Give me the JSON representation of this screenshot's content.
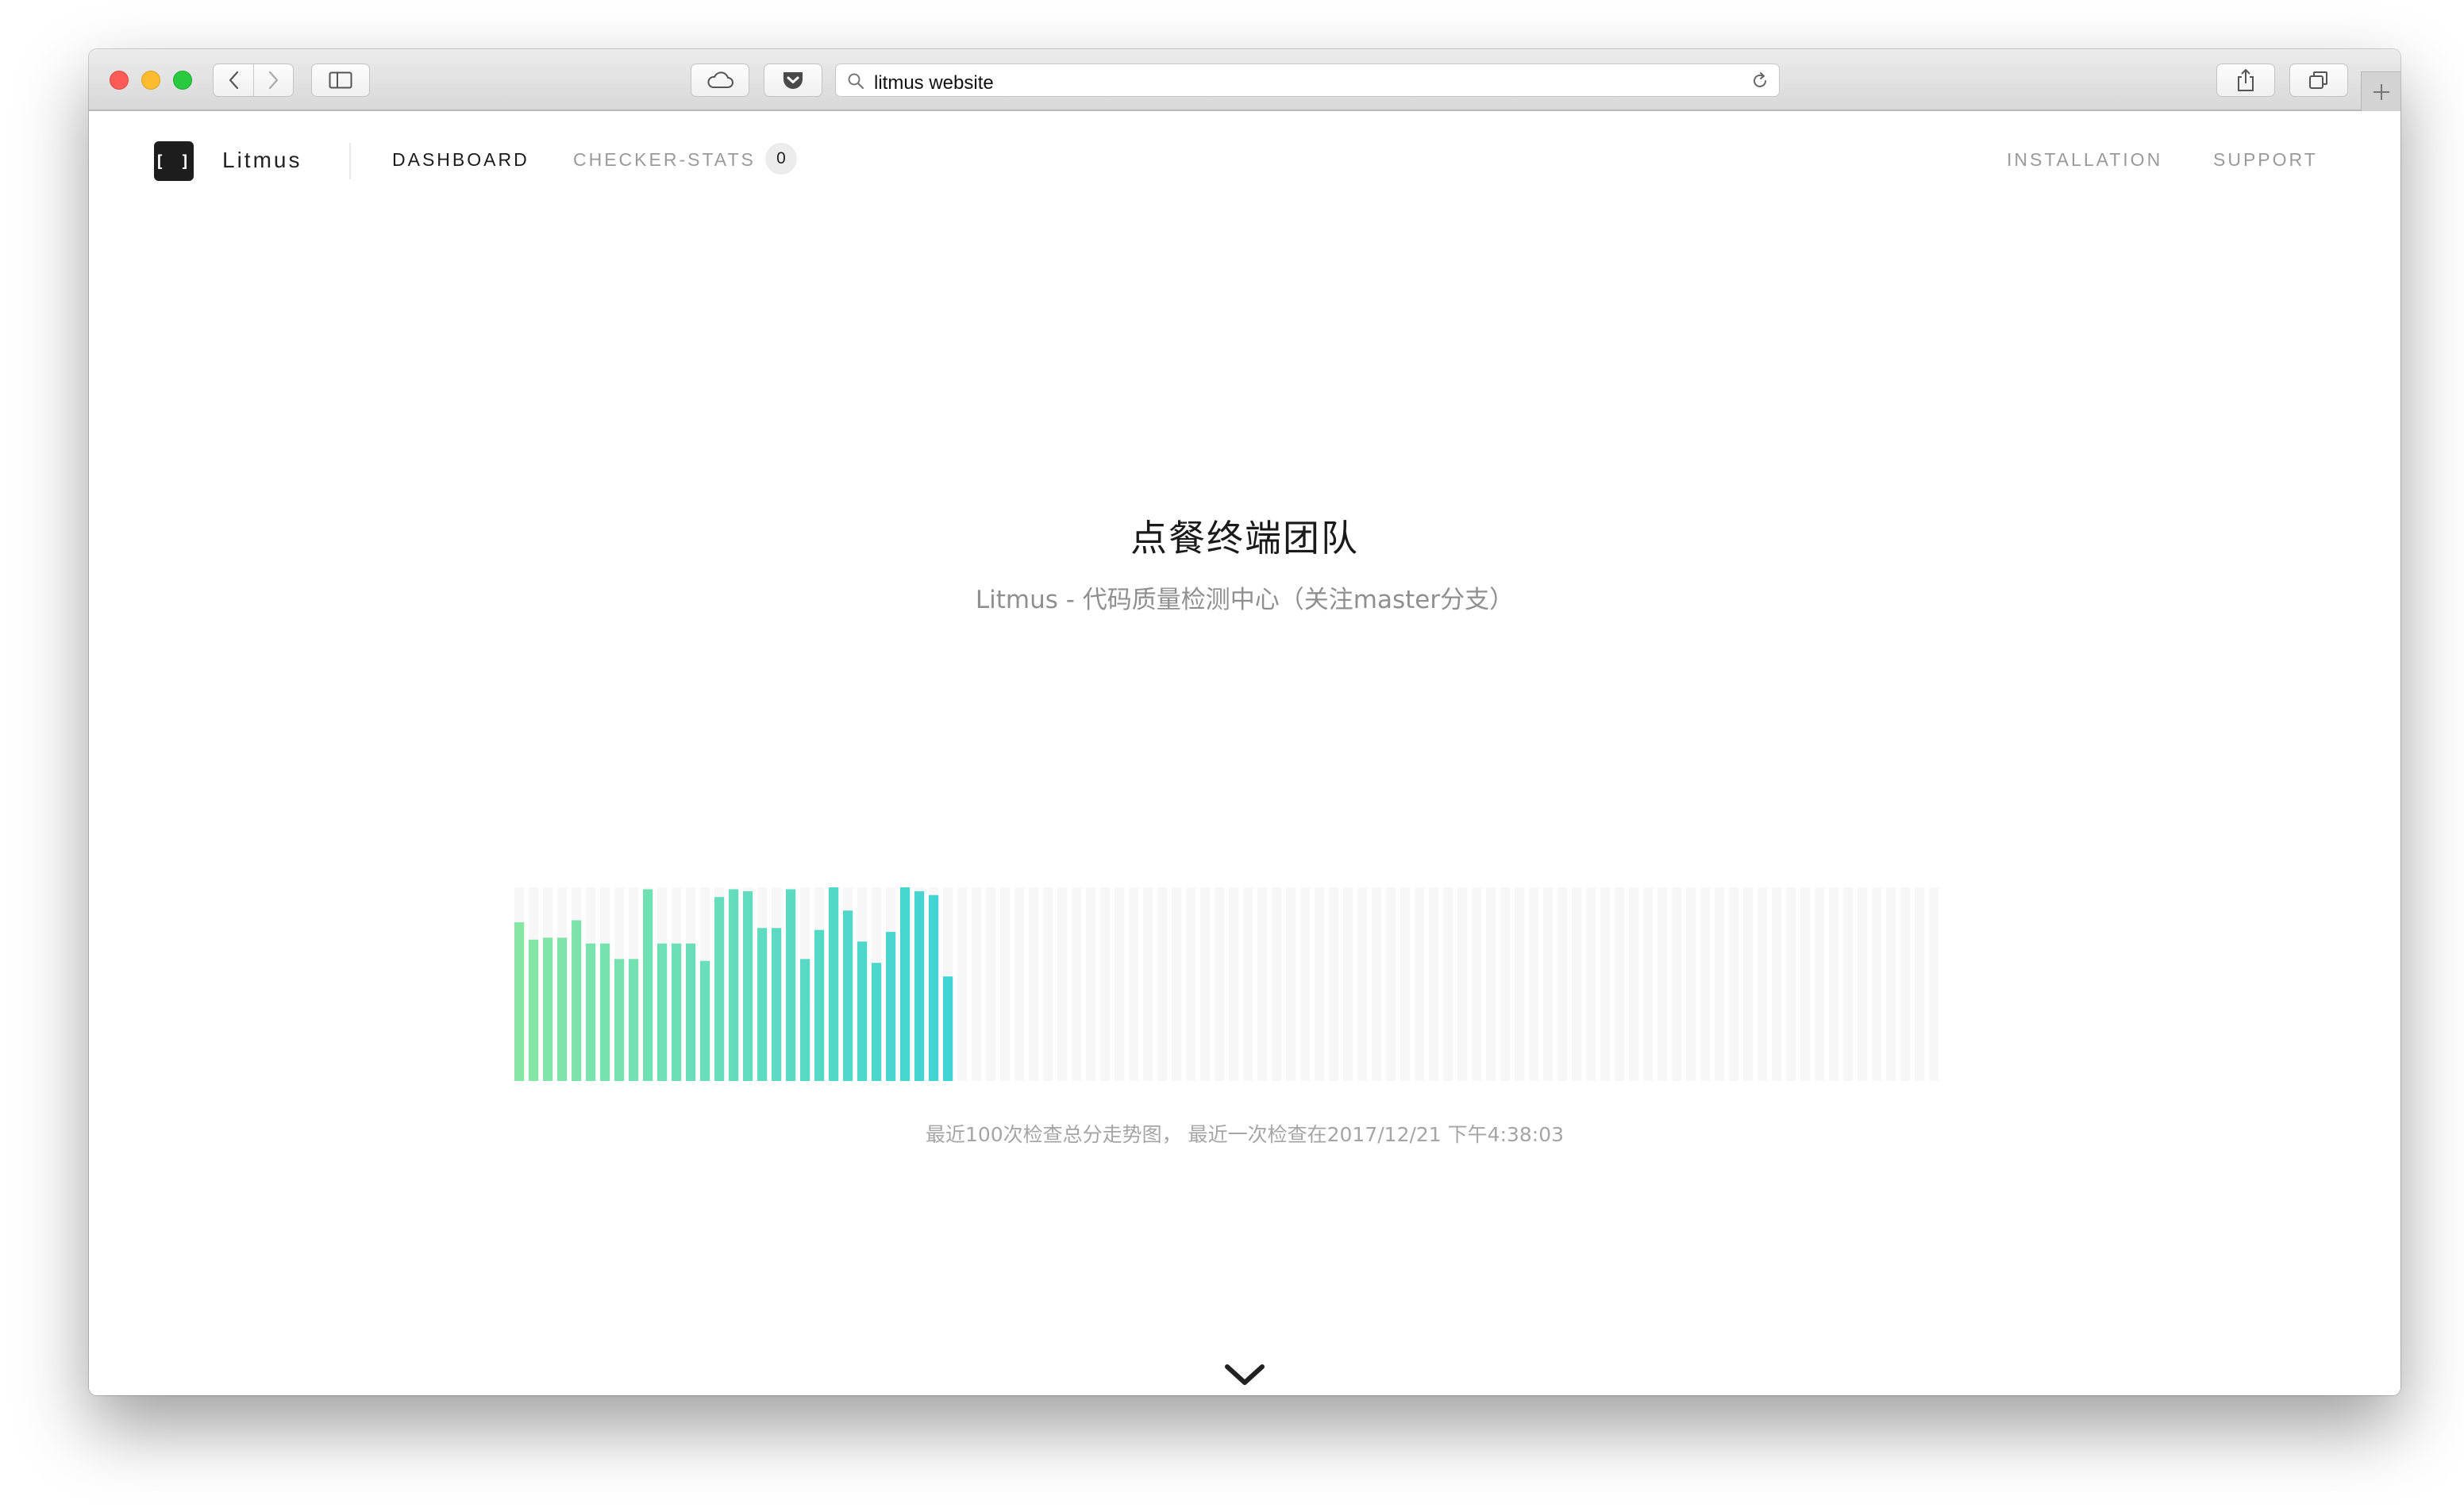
{
  "browser": {
    "url": "litmus website"
  },
  "nav": {
    "logo_glyph": "[ ]",
    "brand": "Litmus",
    "links": {
      "dashboard": "DASHBOARD",
      "checker_stats": "CHECKER-STATS",
      "checker_stats_count": "0",
      "installation": "INSTALLATION",
      "support": "SUPPORT"
    }
  },
  "hero": {
    "title": "点餐终端团队",
    "subtitle": "Litmus - 代码质量检测中心（关注master分支）"
  },
  "chart_caption": "最近100次检查总分走势图， 最近一次检查在2017/12/21 下午4:38:03",
  "colors": {
    "bar_start": "#87e6a4",
    "bar_end": "#3fd3d6",
    "bar_empty": "#f7f7f7",
    "traffic_red": "#fd5b55",
    "traffic_yellow": "#fdbb2e",
    "traffic_green": "#29c940"
  },
  "icons": {
    "back": "chevron-left-icon",
    "forward": "chevron-right-icon",
    "sidebar": "sidebar-icon",
    "cloud": "icloud-tabs-icon",
    "pocket": "pocket-icon",
    "search": "search-icon",
    "reload": "reload-icon",
    "share": "share-icon",
    "tabs": "show-all-tabs-icon",
    "new_tab": "plus-icon",
    "scroll_down": "chevron-down-icon"
  },
  "chart_data": {
    "type": "bar",
    "title": "",
    "xlabel": "",
    "ylabel": "",
    "ylim": [
      0,
      100
    ],
    "slots": 100,
    "values": [
      82,
      73,
      74,
      74,
      83,
      71,
      71,
      63,
      63,
      99,
      71,
      71,
      71,
      62,
      95,
      99,
      98,
      79,
      79,
      99,
      63,
      78,
      100,
      88,
      72,
      61,
      77,
      100,
      98,
      96,
      54
    ]
  }
}
